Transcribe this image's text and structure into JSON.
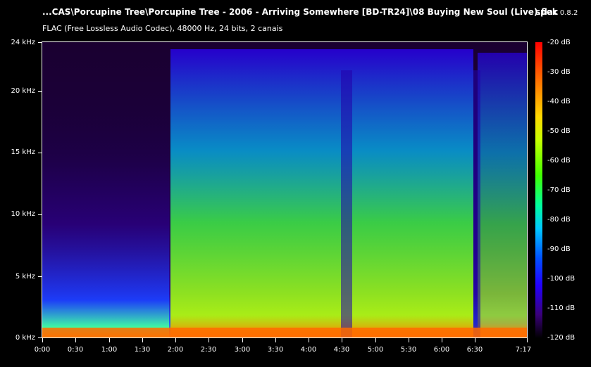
{
  "header": {
    "title": "...CAS\\Porcupine Tree\\Porcupine Tree - 2006 - Arriving Somewhere [BD-TR24]\\08 Buying New Soul (Live).flac",
    "app_name": "spek",
    "app_version": "0.8.2",
    "info": "FLAC (Free Lossless Audio Codec), 48000 Hz, 24 bits, 2 canais"
  },
  "freq_axis": [
    "24 kHz",
    "20 kHz",
    "15 kHz",
    "10 kHz",
    "5 kHz",
    "0 kHz"
  ],
  "db_axis": [
    "-20 dB",
    "-30 dB",
    "-40 dB",
    "-50 dB",
    "-60 dB",
    "-70 dB",
    "-80 dB",
    "-90 dB",
    "-100 dB",
    "-110 dB",
    "-120 dB"
  ],
  "time_axis": [
    "0:00",
    "0:30",
    "1:00",
    "1:30",
    "2:00",
    "2:30",
    "3:00",
    "3:30",
    "4:00",
    "4:30",
    "5:00",
    "5:30",
    "6:00",
    "6:30",
    "7:17"
  ],
  "colors": {
    "background": "#000000",
    "text": "#ffffff",
    "scale_top": "#ff0000",
    "scale_mid": "#40ff00",
    "scale_low": "#2200ff"
  }
}
